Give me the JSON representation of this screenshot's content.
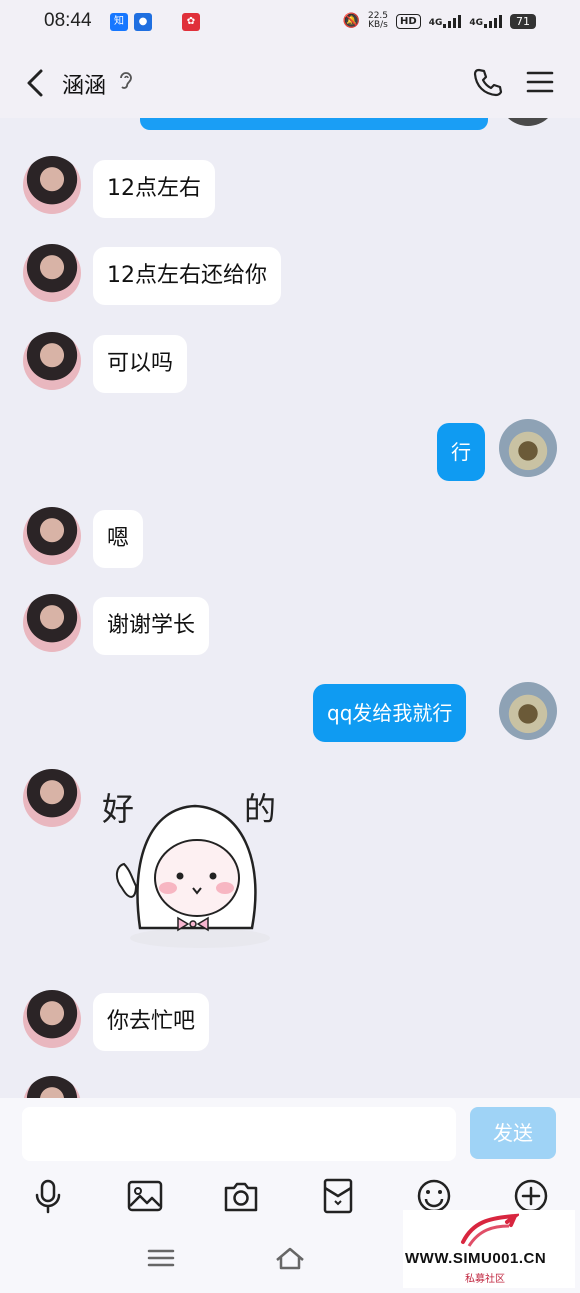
{
  "status_bar": {
    "time": "08:44",
    "net_speed_top": "22.5",
    "net_speed_bottom": "KB/s",
    "hd_badge": "HD",
    "sig1_label": "4G",
    "sig2_label": "4G",
    "battery": "71"
  },
  "header": {
    "title": "涵涵"
  },
  "messages": [
    {
      "sender": "contact",
      "text": "12点左右"
    },
    {
      "sender": "contact",
      "text": "12点左右还给你"
    },
    {
      "sender": "contact",
      "text": "可以吗"
    },
    {
      "sender": "me",
      "text": "行"
    },
    {
      "sender": "contact",
      "text": "嗯"
    },
    {
      "sender": "contact",
      "text": "谢谢学长"
    },
    {
      "sender": "me",
      "text": "qq发给我就行"
    },
    {
      "sender": "contact",
      "sticker": true,
      "sticker_text_left": "好",
      "sticker_text_right": "的"
    },
    {
      "sender": "contact",
      "text": "你去忙吧"
    }
  ],
  "composer": {
    "input_value": "",
    "send_label": "发送"
  },
  "toolbar": [
    "mic-icon",
    "image-icon",
    "camera-icon",
    "red-packet-icon",
    "emoji-icon",
    "plus-icon"
  ],
  "watermark": {
    "text": "WWW.SIMU001.CN",
    "sub": "私募社区"
  },
  "colors": {
    "outgoing_bubble": "#0f9bf2",
    "incoming_bubble": "#ffffff",
    "chat_bg": "#ededf5",
    "send_button": "#9fd3f6"
  }
}
